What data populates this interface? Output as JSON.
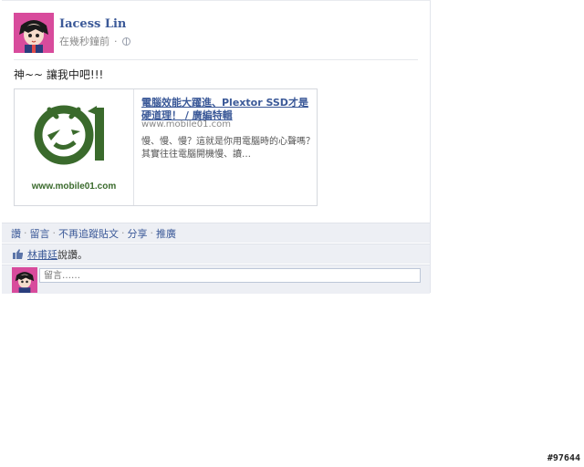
{
  "author": {
    "name": "Iacess Lin"
  },
  "post": {
    "timestamp": "在幾秒鐘前",
    "message": "神~~ 讓我中吧!!!"
  },
  "attachment": {
    "title": "電腦效能大躍進、Plextor SSD才是硬道理！ / 廣編特輯",
    "url": "www.mobile01.com",
    "description": "慢、慢、慢？這就是你用電腦時的心聲嗎？其實往往電腦開機慢、讀…",
    "thumb_site": "www.mobile01.com"
  },
  "actions": {
    "like": "讚",
    "comment": "留言",
    "unfollow": "不再追蹤貼文",
    "share": "分享",
    "promote": "推廣",
    "separator": "·"
  },
  "likes": {
    "person": "林甫廷",
    "text": "說讚。"
  },
  "comment_box": {
    "placeholder": "留言……"
  },
  "watermark": "#97644",
  "colors": {
    "link": "#3b5998",
    "bar_bg": "#edeff4",
    "logo_green": "#3a6a2c"
  },
  "icons": [
    "globe-icon",
    "thumbs-up-icon",
    "mobile01-logo"
  ]
}
